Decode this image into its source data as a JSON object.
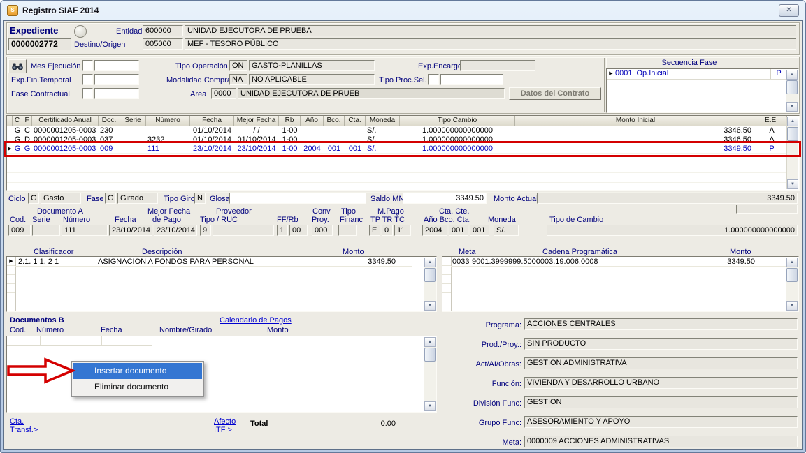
{
  "window": {
    "title": "Registro SIAF 2014",
    "close_glyph": "✕",
    "icon_letter": "S"
  },
  "icons": {
    "up": "▲",
    "down": "▼",
    "marker": "▶"
  },
  "expediente": {
    "label": "Expediente",
    "numero": "0000002772",
    "entidad_label": "Entidad",
    "entidad_code": "600000",
    "entidad_name": "UNIDAD EJECUTORA DE PRUEBA",
    "destino_label": "Destino/Origen",
    "destino_code": "005000",
    "destino_name": "MEF - TESORO PÚBLICO"
  },
  "cabecera": {
    "mes_ejecucion": "Mes Ejecución",
    "tipo_operacion": "Tipo Operación",
    "tipo_operacion_cod": "ON",
    "tipo_operacion_desc": "GASTO-PLANILLAS",
    "exp_encargo": "Exp.Encargo",
    "exp_fin_temporal": "Exp.Fin.Temporal",
    "modalidad_compra": "Modalidad Compra",
    "modalidad_compra_cod": "NA",
    "modalidad_compra_desc": "NO APLICABLE",
    "tipo_proc_sel": "Tipo Proc.Sel.",
    "fase_contractual": "Fase Contractual",
    "area": "Area",
    "area_cod": "0000",
    "area_desc": "UNIDAD EJECUTORA DE PRUEB",
    "datos_contrato": "Datos del Contrato"
  },
  "secuencia": {
    "titulo": "Secuencia Fase",
    "item_numero": "0001",
    "item_nombre": "Op.Inicial",
    "item_estado": "P"
  },
  "grid": {
    "columns": [
      "C",
      "F",
      "Certificado Anual",
      "Doc.",
      "Serie",
      "Número",
      "Fecha",
      "Mejor Fecha",
      "Rb",
      "Año",
      "Bco.",
      "Cta.",
      "Moneda",
      "Tipo Cambio",
      "Monto Inicial",
      "E.E."
    ],
    "rows": [
      [
        "G",
        "C",
        "0000001205-0003",
        "230",
        "",
        "",
        "01/10/2014",
        "/  /",
        "1-00",
        "",
        "",
        "",
        "S/.",
        "1.000000000000000",
        "3346.50",
        "A"
      ],
      [
        "G",
        "D",
        "0000001205-0003",
        "037",
        "",
        "3232",
        "01/10/2014",
        "01/10/2014",
        "1-00",
        "",
        "",
        "",
        "S/.",
        "1.000000000000000",
        "3346.50",
        "A"
      ],
      [
        "G",
        "G",
        "0000001205-0003",
        "009",
        "",
        "111",
        "23/10/2014",
        "23/10/2014",
        "1-00",
        "2004",
        "001",
        "001",
        "S/.",
        "1.000000000000000",
        "3349.50",
        "P"
      ]
    ],
    "selected_row": 2
  },
  "ciclo": {
    "ciclo": "Ciclo",
    "ciclo_cod": "G",
    "ciclo_desc": "Gasto",
    "fase": "Fase",
    "fase_cod": "G",
    "fase_desc": "Girado",
    "tipo_giro": "Tipo Giro",
    "tipo_giro_cod": "N",
    "glosa": "Glosa",
    "glosa_valor": "",
    "saldo_mn": "Saldo MN",
    "saldo_valor": "3349.50",
    "monto_actual": "Monto Actual",
    "monto_actual_valor": "3349.50"
  },
  "doc_a": {
    "titulo": "Documento A",
    "mejor_fecha": "Mejor Fecha",
    "proveedor": "Proveedor",
    "conv": "Conv",
    "tipo": "Tipo",
    "m_pago": "M.Pago",
    "cta_cte": "Cta. Cte.",
    "cod": "Cod.",
    "serie": "Serie",
    "numero": "Número",
    "fecha": "Fecha",
    "de_pago": "de Pago",
    "tipo_ruc": "Tipo / RUC",
    "ff_rb": "FF/Rb",
    "proy": "Proy.",
    "financ": "Financ",
    "tp_tr_tc": "TP TR TC",
    "ano_bco_cta": "Año Bco. Cta.",
    "moneda": "Moneda",
    "tipo_cambio": "Tipo de Cambio",
    "v_cod": "009",
    "v_serie": "",
    "v_numero": "111",
    "v_fecha": "23/10/2014",
    "v_mejor_fecha": "23/10/2014",
    "v_prov_tipo": "9",
    "v_prov_ruc": "",
    "v_ff": "1",
    "v_rb": "00",
    "v_proy": "000",
    "v_financ": "",
    "v_tp": "E",
    "v_tr": "0",
    "v_tc": "11",
    "v_ano": "2004",
    "v_bco": "001",
    "v_cta": "001",
    "v_moneda": "S/.",
    "v_tipo_cambio": "1.000000000000000"
  },
  "clasificador": {
    "h_clasificador": "Clasificador",
    "h_descripcion": "Descripción",
    "h_monto": "Monto",
    "codigo": "2.1. 1 1. 2 1",
    "descripcion": "ASIGNACION A FONDOS PARA PERSONAL",
    "monto": "3349.50"
  },
  "meta_grid": {
    "h_meta": "Meta",
    "h_cadena": "Cadena Programática",
    "h_monto": "Monto",
    "meta": "0033",
    "cadena": "9001.3999999.5000003.19.006.0008",
    "monto": "3349.50"
  },
  "doc_b": {
    "titulo": "Documentos B",
    "calendario": "Calendario de Pagos",
    "h_cod": "Cod.",
    "h_numero": "Número",
    "h_fecha": "Fecha",
    "h_nombre": "Nombre/Girado",
    "h_monto": "Monto",
    "cta_l1": "Cta.",
    "cta_l2": "Transf.>",
    "afecto_l1": "Afecto",
    "afecto_l2": "ITF >",
    "total": "Total",
    "total_valor": "0.00"
  },
  "menu": {
    "insertar": "Insertar documento",
    "eliminar": "Eliminar documento"
  },
  "programa": {
    "rows": [
      {
        "label": "Programa:",
        "value": "ACCIONES CENTRALES"
      },
      {
        "label": "Prod./Proy.:",
        "value": "SIN PRODUCTO"
      },
      {
        "label": "Act/AI/Obras:",
        "value": "GESTION ADMINISTRATIVA"
      },
      {
        "label": "Función:",
        "value": "VIVIENDA Y DESARROLLO URBANO"
      },
      {
        "label": "División Func:",
        "value": "GESTION"
      },
      {
        "label": "Grupo Func:",
        "value": "ASESORAMIENTO Y APOYO"
      },
      {
        "label": "Meta:",
        "value": "0000009 ACCIONES ADMINISTRATIVAS"
      }
    ]
  }
}
